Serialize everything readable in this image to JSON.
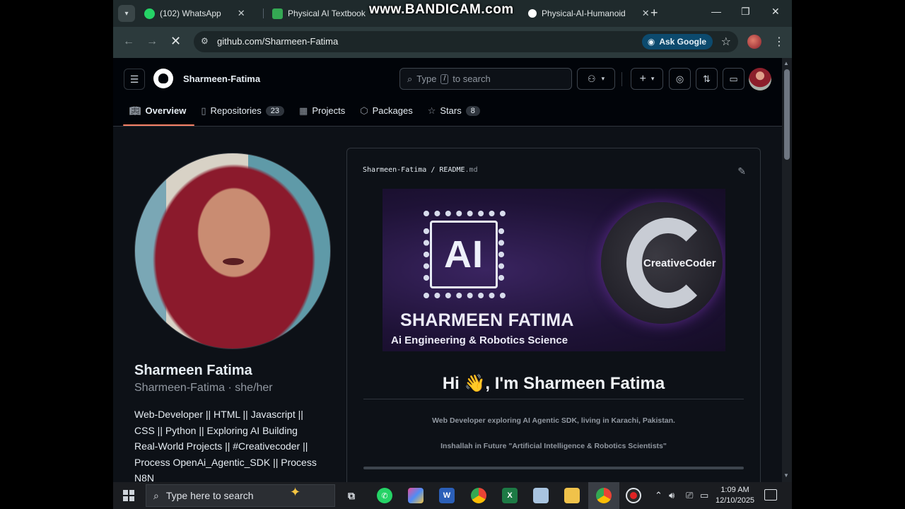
{
  "browser": {
    "tabs": [
      {
        "label": "(102) WhatsApp",
        "favicon_color": "#25d366"
      },
      {
        "label": "Physical AI Textbook",
        "favicon_color": "#34a853"
      },
      {
        "label": "Physical-AI-Humanoid",
        "favicon_color": "#ffffff"
      }
    ],
    "watermark": "www.BANDICAM.com",
    "url": "github.com/Sharmeen-Fatima",
    "ask_google": "Ask Google"
  },
  "github": {
    "username": "Sharmeen-Fatima",
    "search_prefix": "Type",
    "search_key": "/",
    "search_suffix": "to search",
    "nav": [
      {
        "label": "Overview",
        "icon": "book-icon",
        "active": true
      },
      {
        "label": "Repositories",
        "icon": "repo-icon",
        "count": "23"
      },
      {
        "label": "Projects",
        "icon": "table-icon"
      },
      {
        "label": "Packages",
        "icon": "package-icon"
      },
      {
        "label": "Stars",
        "icon": "star-icon",
        "count": "8"
      }
    ],
    "accent": "#f78166"
  },
  "profile": {
    "name": "Sharmeen Fatima",
    "handle": "Sharmeen-Fatima · she/her",
    "bio": "Web-Developer || HTML || Javascript || CSS || Python || Exploring AI Building Real-World Projects || #Creativecoder || Process OpenAi_Agentic_SDK || Process N8N"
  },
  "readme": {
    "path_owner": "Sharmeen-Fatima",
    "path_sep": "/",
    "path_file": "README",
    "path_ext": ".md",
    "banner_chip_text": "AI",
    "banner_logo_text": "CreativeCoder",
    "banner_name": "SHARMEEN FATIMA",
    "banner_subtitle": "Ai Engineering & Robotics Science",
    "greeting": "Hi 👋, I'm Sharmeen Fatima",
    "line1": "Web Developer exploring AI Agentic SDK, living in Karachi, Pakistan.",
    "line2": "Inshallah in Future \"Artificial Intelligence & Robotics Scientists\""
  },
  "taskbar": {
    "search_placeholder": "Type here to search",
    "time": "1:09 AM",
    "date": "12/10/2025"
  }
}
